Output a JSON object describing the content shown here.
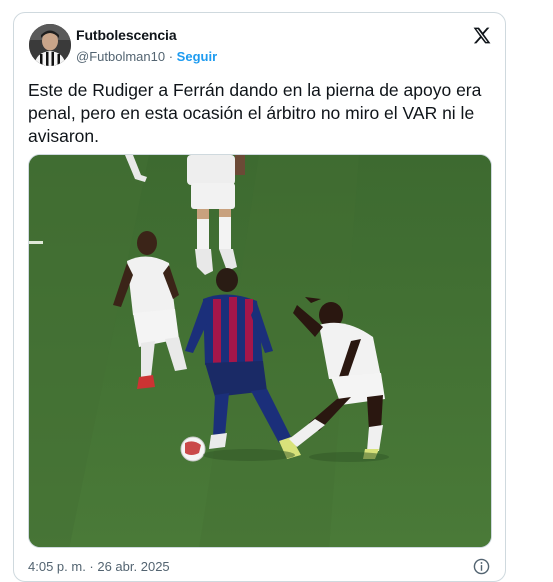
{
  "tweet": {
    "display_name": "Futbolescencia",
    "handle": "@Futbolman10",
    "separator": "·",
    "follow_label": "Seguir",
    "text": "Este de Rudiger a Ferrán dando en la pierna de apoyo era penal, pero en esta ocasión el árbitro no miro el VAR ni le avisaron.",
    "timestamp": "4:05 p. m. · 26 abr. 2025"
  },
  "icons": {
    "platform": "x-logo-icon",
    "info": "info-icon"
  },
  "colors": {
    "link": "#1d9bf0",
    "secondary_text": "#536471",
    "pitch": "#3f6e33",
    "barca_blue": "#1b2f7a",
    "barca_red": "#a5164a"
  }
}
